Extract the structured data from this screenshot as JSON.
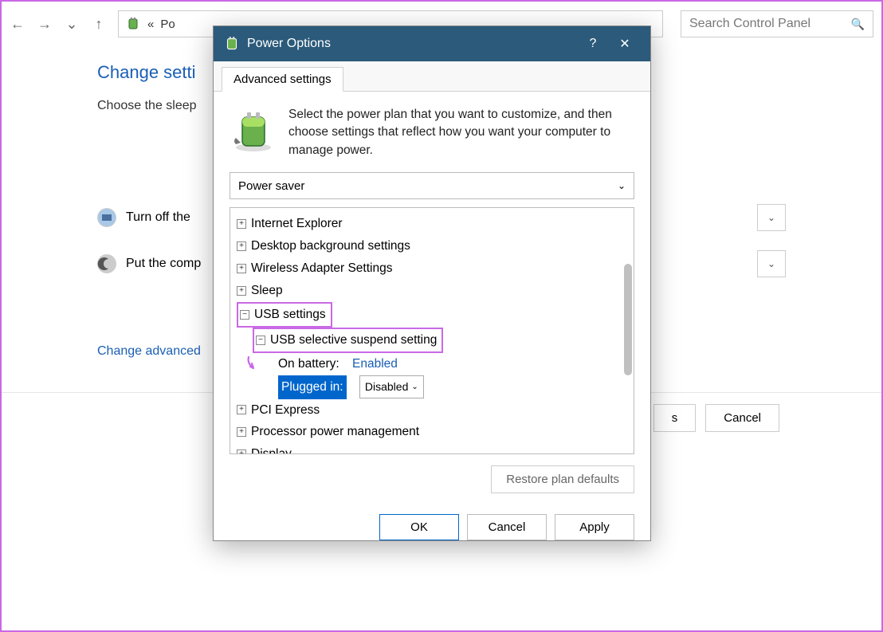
{
  "nav": {
    "back": "←",
    "forward": "→",
    "down": "⌄",
    "up": "↑",
    "crumb_prefix": "«",
    "crumb_text": "Po"
  },
  "search": {
    "placeholder": "Search Control Panel"
  },
  "bg": {
    "title": "Change setti",
    "sub": "Choose the sleep",
    "row1": "Turn off the ",
    "row2": "Put the comp",
    "link": "Change advanced",
    "save": "s",
    "cancel": "Cancel"
  },
  "dialog": {
    "title": "Power Options",
    "tab": "Advanced settings",
    "intro": "Select the power plan that you want to customize, and then choose settings that reflect how you want your computer to manage power.",
    "plan": "Power saver",
    "tree": {
      "ie": "Internet Explorer",
      "desktop": "Desktop background settings",
      "wireless": "Wireless Adapter Settings",
      "sleep": "Sleep",
      "usb": "USB settings",
      "usb_sel": "USB selective suspend setting",
      "batt_label": "On battery:",
      "batt_val": "Enabled",
      "plug_label": "Plugged in:",
      "plug_val": "Disabled",
      "pci": "PCI Express",
      "proc": "Processor power management",
      "display": "Display"
    },
    "restore": "Restore plan defaults",
    "ok": "OK",
    "cancel": "Cancel",
    "apply": "Apply"
  }
}
